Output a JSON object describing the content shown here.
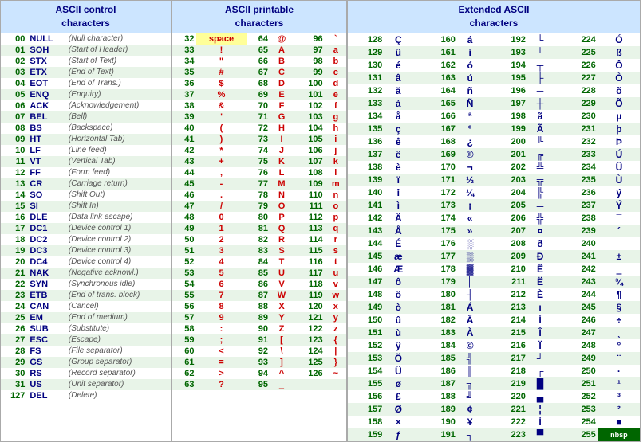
{
  "sections": {
    "control": {
      "title": "ASCII control\ncharacters",
      "rows": [
        {
          "dec": "00",
          "name": "NULL",
          "desc": "(Null character)"
        },
        {
          "dec": "01",
          "name": "SOH",
          "desc": "(Start of Header)"
        },
        {
          "dec": "02",
          "name": "STX",
          "desc": "(Start of Text)"
        },
        {
          "dec": "03",
          "name": "ETX",
          "desc": "(End of Text)"
        },
        {
          "dec": "04",
          "name": "EOT",
          "desc": "(End of Trans.)"
        },
        {
          "dec": "05",
          "name": "ENQ",
          "desc": "(Enquiry)"
        },
        {
          "dec": "06",
          "name": "ACK",
          "desc": "(Acknowledgement)"
        },
        {
          "dec": "07",
          "name": "BEL",
          "desc": "(Bell)"
        },
        {
          "dec": "08",
          "name": "BS",
          "desc": "(Backspace)"
        },
        {
          "dec": "09",
          "name": "HT",
          "desc": "(Horizontal Tab)"
        },
        {
          "dec": "10",
          "name": "LF",
          "desc": "(Line feed)"
        },
        {
          "dec": "11",
          "name": "VT",
          "desc": "(Vertical Tab)"
        },
        {
          "dec": "12",
          "name": "FF",
          "desc": "(Form feed)"
        },
        {
          "dec": "13",
          "name": "CR",
          "desc": "(Carriage return)"
        },
        {
          "dec": "14",
          "name": "SO",
          "desc": "(Shift Out)"
        },
        {
          "dec": "15",
          "name": "SI",
          "desc": "(Shift In)"
        },
        {
          "dec": "16",
          "name": "DLE",
          "desc": "(Data link escape)"
        },
        {
          "dec": "17",
          "name": "DC1",
          "desc": "(Device control 1)"
        },
        {
          "dec": "18",
          "name": "DC2",
          "desc": "(Device control 2)"
        },
        {
          "dec": "19",
          "name": "DC3",
          "desc": "(Device control 3)"
        },
        {
          "dec": "20",
          "name": "DC4",
          "desc": "(Device control 4)"
        },
        {
          "dec": "21",
          "name": "NAK",
          "desc": "(Negative acknowl.)"
        },
        {
          "dec": "22",
          "name": "SYN",
          "desc": "(Synchronous idle)"
        },
        {
          "dec": "23",
          "name": "ETB",
          "desc": "(End of trans. block)"
        },
        {
          "dec": "24",
          "name": "CAN",
          "desc": "(Cancel)"
        },
        {
          "dec": "25",
          "name": "EM",
          "desc": "(End of medium)"
        },
        {
          "dec": "26",
          "name": "SUB",
          "desc": "(Substitute)"
        },
        {
          "dec": "27",
          "name": "ESC",
          "desc": "(Escape)"
        },
        {
          "dec": "28",
          "name": "FS",
          "desc": "(File separator)"
        },
        {
          "dec": "29",
          "name": "GS",
          "desc": "(Group separator)"
        },
        {
          "dec": "30",
          "name": "RS",
          "desc": "(Record separator)"
        },
        {
          "dec": "31",
          "name": "US",
          "desc": "(Unit separator)"
        },
        {
          "dec": "127",
          "name": "DEL",
          "desc": "(Delete)"
        }
      ]
    },
    "printable": {
      "title": "ASCII printable\ncharacters",
      "rows": [
        {
          "dec": "32",
          "char": "space",
          "dec2": "64",
          "char2": "@",
          "dec3": "96",
          "char3": "`"
        },
        {
          "dec": "33",
          "char": "!",
          "dec2": "65",
          "char2": "A",
          "dec3": "97",
          "char3": "a"
        },
        {
          "dec": "34",
          "char": "\"",
          "dec2": "66",
          "char2": "B",
          "dec3": "98",
          "char3": "b"
        },
        {
          "dec": "35",
          "char": "#",
          "dec2": "67",
          "char2": "C",
          "dec3": "99",
          "char3": "c"
        },
        {
          "dec": "36",
          "char": "$",
          "dec2": "68",
          "char2": "D",
          "dec3": "100",
          "char3": "d"
        },
        {
          "dec": "37",
          "char": "%",
          "dec2": "69",
          "char2": "E",
          "dec3": "101",
          "char3": "e"
        },
        {
          "dec": "38",
          "char": "&",
          "dec2": "70",
          "char2": "F",
          "dec3": "102",
          "char3": "f"
        },
        {
          "dec": "39",
          "char": "'",
          "dec2": "71",
          "char2": "G",
          "dec3": "103",
          "char3": "g"
        },
        {
          "dec": "40",
          "char": "(",
          "dec2": "72",
          "char2": "H",
          "dec3": "104",
          "char3": "h"
        },
        {
          "dec": "41",
          "char": ")",
          "dec2": "73",
          "char2": "I",
          "dec3": "105",
          "char3": "i"
        },
        {
          "dec": "42",
          "char": "*",
          "dec2": "74",
          "char2": "J",
          "dec3": "106",
          "char3": "j"
        },
        {
          "dec": "43",
          "char": "+",
          "dec2": "75",
          "char2": "K",
          "dec3": "107",
          "char3": "k"
        },
        {
          "dec": "44",
          "char": ",",
          "dec2": "76",
          "char2": "L",
          "dec3": "108",
          "char3": "l"
        },
        {
          "dec": "45",
          "char": "-",
          "dec2": "77",
          "char2": "M",
          "dec3": "109",
          "char3": "m"
        },
        {
          "dec": "46",
          "char": ".",
          "dec2": "78",
          "char2": "N",
          "dec3": "110",
          "char3": "n"
        },
        {
          "dec": "47",
          "char": "/",
          "dec2": "79",
          "char2": "O",
          "dec3": "111",
          "char3": "o"
        },
        {
          "dec": "48",
          "char": "0",
          "dec2": "80",
          "char2": "P",
          "dec3": "112",
          "char3": "p"
        },
        {
          "dec": "49",
          "char": "1",
          "dec2": "81",
          "char2": "Q",
          "dec3": "113",
          "char3": "q"
        },
        {
          "dec": "50",
          "char": "2",
          "dec2": "82",
          "char2": "R",
          "dec3": "114",
          "char3": "r"
        },
        {
          "dec": "51",
          "char": "3",
          "dec2": "83",
          "char2": "S",
          "dec3": "115",
          "char3": "s"
        },
        {
          "dec": "52",
          "char": "4",
          "dec2": "84",
          "char2": "T",
          "dec3": "116",
          "char3": "t"
        },
        {
          "dec": "53",
          "char": "5",
          "dec2": "85",
          "char2": "U",
          "dec3": "117",
          "char3": "u"
        },
        {
          "dec": "54",
          "char": "6",
          "dec2": "86",
          "char2": "V",
          "dec3": "118",
          "char3": "v"
        },
        {
          "dec": "55",
          "char": "7",
          "dec2": "87",
          "char2": "W",
          "dec3": "119",
          "char3": "w"
        },
        {
          "dec": "56",
          "char": "8",
          "dec2": "88",
          "char2": "X",
          "dec3": "120",
          "char3": "x"
        },
        {
          "dec": "57",
          "char": "9",
          "dec2": "89",
          "char2": "Y",
          "dec3": "121",
          "char3": "y"
        },
        {
          "dec": "58",
          "char": ":",
          "dec2": "90",
          "char2": "Z",
          "dec3": "122",
          "char3": "z"
        },
        {
          "dec": "59",
          "char": ";",
          "dec2": "91",
          "char2": "[",
          "dec3": "123",
          "char3": "{"
        },
        {
          "dec": "60",
          "char": "<",
          "dec2": "92",
          "char2": "\\",
          "dec3": "124",
          "char3": "|"
        },
        {
          "dec": "61",
          "char": "=",
          "dec2": "93",
          "char2": "]",
          "dec3": "125",
          "char3": "}"
        },
        {
          "dec": "62",
          "char": ">",
          "dec2": "94",
          "char2": "^",
          "dec3": "126",
          "char3": "~"
        },
        {
          "dec": "63",
          "char": "?",
          "dec2": "95",
          "char2": "_",
          "dec3": "",
          "char3": ""
        }
      ]
    },
    "extended": {
      "title": "Extended ASCII\ncharacters",
      "rows": [
        [
          {
            "dec": "128",
            "char": "Ç"
          },
          {
            "dec": "160",
            "char": "á"
          },
          {
            "dec": "192",
            "char": "└"
          },
          {
            "dec": "224",
            "char": "Ó"
          }
        ],
        [
          {
            "dec": "129",
            "char": "ü"
          },
          {
            "dec": "161",
            "char": "í"
          },
          {
            "dec": "193",
            "char": "┴"
          },
          {
            "dec": "225",
            "char": "ß"
          }
        ],
        [
          {
            "dec": "130",
            "char": "é"
          },
          {
            "dec": "162",
            "char": "ó"
          },
          {
            "dec": "194",
            "char": "┬"
          },
          {
            "dec": "226",
            "char": "Ô"
          }
        ],
        [
          {
            "dec": "131",
            "char": "â"
          },
          {
            "dec": "163",
            "char": "ú"
          },
          {
            "dec": "195",
            "char": "├"
          },
          {
            "dec": "227",
            "char": "Ò"
          }
        ],
        [
          {
            "dec": "132",
            "char": "ä"
          },
          {
            "dec": "164",
            "char": "ñ"
          },
          {
            "dec": "196",
            "char": "─"
          },
          {
            "dec": "228",
            "char": "õ"
          }
        ],
        [
          {
            "dec": "133",
            "char": "à"
          },
          {
            "dec": "165",
            "char": "Ñ"
          },
          {
            "dec": "197",
            "char": "┼"
          },
          {
            "dec": "229",
            "char": "Õ"
          }
        ],
        [
          {
            "dec": "134",
            "char": "å"
          },
          {
            "dec": "166",
            "char": "ª"
          },
          {
            "dec": "198",
            "char": "ã"
          },
          {
            "dec": "230",
            "char": "µ"
          }
        ],
        [
          {
            "dec": "135",
            "char": "ç"
          },
          {
            "dec": "167",
            "char": "º"
          },
          {
            "dec": "199",
            "char": "Ã"
          },
          {
            "dec": "231",
            "char": "þ"
          }
        ],
        [
          {
            "dec": "136",
            "char": "ê"
          },
          {
            "dec": "168",
            "char": "¿"
          },
          {
            "dec": "200",
            "char": "╚"
          },
          {
            "dec": "232",
            "char": "Þ"
          }
        ],
        [
          {
            "dec": "137",
            "char": "ë"
          },
          {
            "dec": "169",
            "char": "®"
          },
          {
            "dec": "201",
            "char": "╔"
          },
          {
            "dec": "233",
            "char": "Ú"
          }
        ],
        [
          {
            "dec": "138",
            "char": "è"
          },
          {
            "dec": "170",
            "char": "¬"
          },
          {
            "dec": "202",
            "char": "╩"
          },
          {
            "dec": "234",
            "char": "Û"
          }
        ],
        [
          {
            "dec": "139",
            "char": "ï"
          },
          {
            "dec": "171",
            "char": "½"
          },
          {
            "dec": "203",
            "char": "╦"
          },
          {
            "dec": "235",
            "char": "Ù"
          }
        ],
        [
          {
            "dec": "140",
            "char": "î"
          },
          {
            "dec": "172",
            "char": "¼"
          },
          {
            "dec": "204",
            "char": "╠"
          },
          {
            "dec": "236",
            "char": "ý"
          }
        ],
        [
          {
            "dec": "141",
            "char": "ì"
          },
          {
            "dec": "173",
            "char": "¡"
          },
          {
            "dec": "205",
            "char": "═"
          },
          {
            "dec": "237",
            "char": "Ý"
          }
        ],
        [
          {
            "dec": "142",
            "char": "Ä"
          },
          {
            "dec": "174",
            "char": "«"
          },
          {
            "dec": "206",
            "char": "╬"
          },
          {
            "dec": "238",
            "char": "¯"
          }
        ],
        [
          {
            "dec": "143",
            "char": "Å"
          },
          {
            "dec": "175",
            "char": "»"
          },
          {
            "dec": "207",
            "char": "¤"
          },
          {
            "dec": "239",
            "char": "´"
          }
        ],
        [
          {
            "dec": "144",
            "char": "É"
          },
          {
            "dec": "176",
            "char": "░"
          },
          {
            "dec": "208",
            "char": "ð"
          },
          {
            "dec": "240",
            "char": "­"
          }
        ],
        [
          {
            "dec": "145",
            "char": "æ"
          },
          {
            "dec": "177",
            "char": "▒"
          },
          {
            "dec": "209",
            "char": "Ð"
          },
          {
            "dec": "241",
            "char": "±"
          }
        ],
        [
          {
            "dec": "146",
            "char": "Æ"
          },
          {
            "dec": "178",
            "char": "▓"
          },
          {
            "dec": "210",
            "char": "Ê"
          },
          {
            "dec": "242",
            "char": "‗"
          }
        ],
        [
          {
            "dec": "147",
            "char": "ô"
          },
          {
            "dec": "179",
            "char": "│"
          },
          {
            "dec": "211",
            "char": "Ë"
          },
          {
            "dec": "243",
            "char": "¾"
          }
        ],
        [
          {
            "dec": "148",
            "char": "ö"
          },
          {
            "dec": "180",
            "char": "┤"
          },
          {
            "dec": "212",
            "char": "È"
          },
          {
            "dec": "244",
            "char": "¶"
          }
        ],
        [
          {
            "dec": "149",
            "char": "ò"
          },
          {
            "dec": "181",
            "char": "Á"
          },
          {
            "dec": "213",
            "char": "ı"
          },
          {
            "dec": "245",
            "char": "§"
          }
        ],
        [
          {
            "dec": "150",
            "char": "û"
          },
          {
            "dec": "182",
            "char": "Â"
          },
          {
            "dec": "214",
            "char": "Í"
          },
          {
            "dec": "246",
            "char": "÷"
          }
        ],
        [
          {
            "dec": "151",
            "char": "ù"
          },
          {
            "dec": "183",
            "char": "À"
          },
          {
            "dec": "215",
            "char": "Î"
          },
          {
            "dec": "247",
            "char": "¸"
          }
        ],
        [
          {
            "dec": "152",
            "char": "ÿ"
          },
          {
            "dec": "184",
            "char": "©"
          },
          {
            "dec": "216",
            "char": "Ï"
          },
          {
            "dec": "248",
            "char": "°"
          }
        ],
        [
          {
            "dec": "153",
            "char": "Ö"
          },
          {
            "dec": "185",
            "char": "╣"
          },
          {
            "dec": "217",
            "char": "┘"
          },
          {
            "dec": "249",
            "char": "¨"
          }
        ],
        [
          {
            "dec": "154",
            "char": "Ü"
          },
          {
            "dec": "186",
            "char": "║"
          },
          {
            "dec": "218",
            "char": "┌"
          },
          {
            "dec": "250",
            "char": "·"
          }
        ],
        [
          {
            "dec": "155",
            "char": "ø"
          },
          {
            "dec": "187",
            "char": "╗"
          },
          {
            "dec": "219",
            "char": "█"
          },
          {
            "dec": "251",
            "char": "¹"
          }
        ],
        [
          {
            "dec": "156",
            "char": "£"
          },
          {
            "dec": "188",
            "char": "╝"
          },
          {
            "dec": "220",
            "char": "▄"
          },
          {
            "dec": "252",
            "char": "³"
          }
        ],
        [
          {
            "dec": "157",
            "char": "Ø"
          },
          {
            "dec": "189",
            "char": "¢"
          },
          {
            "dec": "221",
            "char": "¦"
          },
          {
            "dec": "253",
            "char": "²"
          }
        ],
        [
          {
            "dec": "158",
            "char": "×"
          },
          {
            "dec": "190",
            "char": "¥"
          },
          {
            "dec": "222",
            "char": "Ì"
          },
          {
            "dec": "254",
            "char": "■"
          }
        ],
        [
          {
            "dec": "159",
            "char": "ƒ"
          },
          {
            "dec": "191",
            "char": "┐"
          },
          {
            "dec": "223",
            "char": "▀"
          },
          {
            "dec": "255",
            "char": "nbsp"
          }
        ]
      ]
    }
  }
}
